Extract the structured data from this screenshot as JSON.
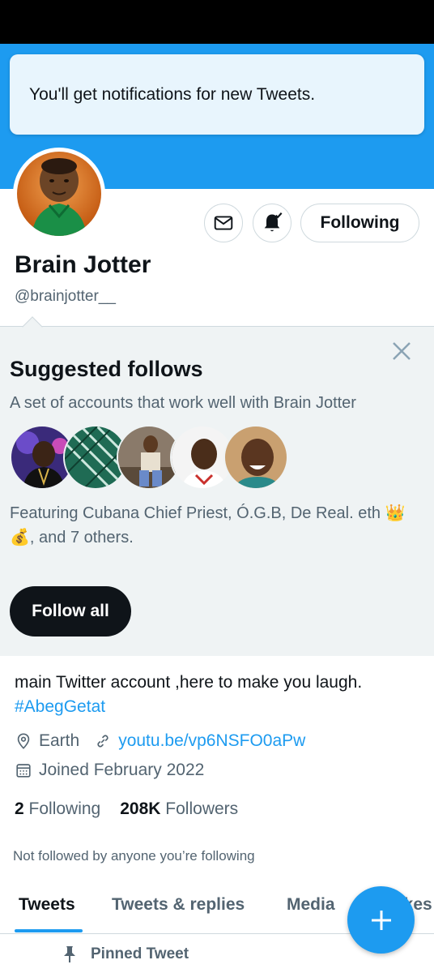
{
  "toast": {
    "text": "You'll get notifications for new Tweets."
  },
  "profile": {
    "display_name": "Brain Jotter",
    "handle": "@brainjotter__",
    "bio": "main Twitter account ,here to make you laugh.",
    "hashtag": "#AbegGetat",
    "location": "Earth",
    "website": "youtu.be/vp6NSFO0aPw",
    "joined": "Joined February 2022",
    "following_count": "2",
    "following_label": "Following",
    "followers_count": "208K",
    "followers_label": "Followers",
    "not_followed_text": "Not followed by anyone you’re following"
  },
  "actions": {
    "message_icon": "envelope-icon",
    "notify_icon": "bell-check-icon",
    "follow_label": "Following"
  },
  "suggested": {
    "title": "Suggested follows",
    "subtitle": "A set of accounts that work well with Brain Jotter",
    "featuring": "Featuring Cubana Chief Priest, Ó.G.B, De Real. eth 👑💰, and 7 others.",
    "follow_all_label": "Follow all"
  },
  "tabs": [
    {
      "label": "Tweets"
    },
    {
      "label": "Tweets & replies"
    },
    {
      "label": "Media"
    },
    {
      "label": "Likes"
    }
  ],
  "pinned": {
    "label": "Pinned Tweet"
  },
  "colors": {
    "accent": "#1d9bf0",
    "text": "#0f1419",
    "muted": "#536471",
    "panel": "#eff3f4"
  }
}
